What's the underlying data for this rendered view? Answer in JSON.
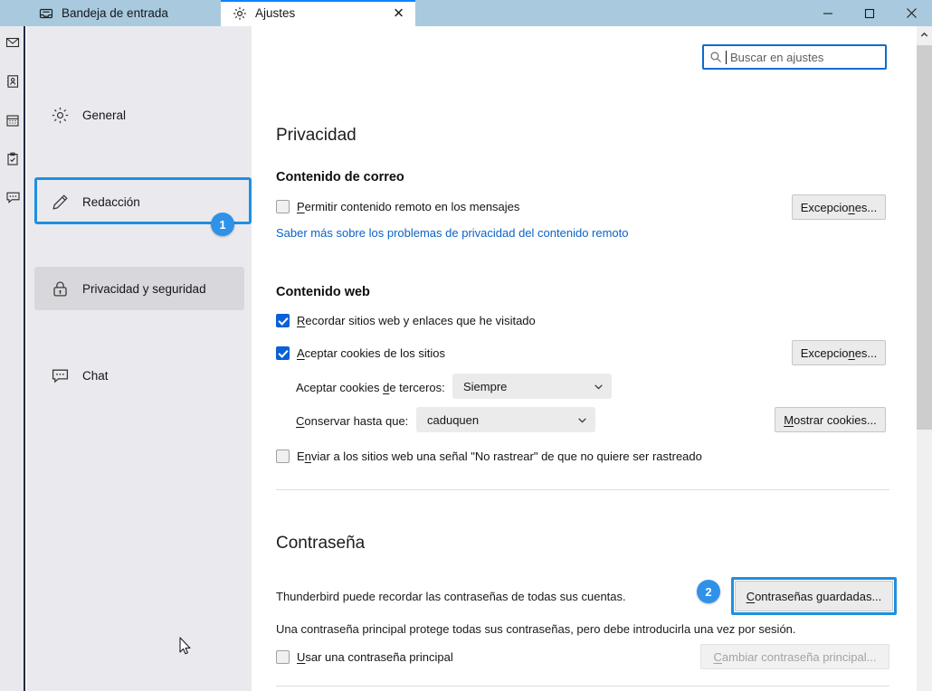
{
  "window": {
    "controls": {
      "minimize": "minimize-icon",
      "maximize": "maximize-icon",
      "close": "close-icon"
    }
  },
  "tabs": [
    {
      "label": "Bandeja de entrada",
      "icon": "inbox-icon",
      "active": false
    },
    {
      "label": "Ajustes",
      "icon": "gear-icon",
      "active": true,
      "closable": true
    }
  ],
  "icon_strip": [
    "mail-icon",
    "address-book-icon",
    "calendar-icon",
    "tasks-icon",
    "chat-icon"
  ],
  "nav": {
    "items": [
      {
        "label": "General",
        "icon": "gear-icon",
        "selected": false
      },
      {
        "label": "Redacción",
        "icon": "pencil-icon",
        "selected": false
      },
      {
        "label": "Privacidad y seguridad",
        "icon": "lock-icon",
        "selected": true,
        "badge": "1"
      },
      {
        "label": "Chat",
        "icon": "chat-bubble-icon",
        "selected": false
      }
    ]
  },
  "search": {
    "placeholder": "Buscar en ajustes",
    "value": "",
    "icon": "search-icon"
  },
  "page": {
    "title": "Privacidad",
    "sections": {
      "mail_content": {
        "heading": "Contenido de correo",
        "allow_remote": {
          "label_pre": "",
          "label_key": "P",
          "label_post": "ermitir contenido remoto en los mensajes",
          "checked": false
        },
        "learn_more_link": "Saber más sobre los problemas de privacidad del contenido remoto",
        "exceptions_button": {
          "pre": "Excepcio",
          "key": "n",
          "post": "es..."
        }
      },
      "web_content": {
        "heading": "Contenido web",
        "remember_sites": {
          "label_pre": "",
          "label_key": "R",
          "label_post": "ecordar sitios web y enlaces que he visitado",
          "checked": true
        },
        "accept_cookies": {
          "label_pre": "",
          "label_key": "A",
          "label_post": "ceptar cookies de los sitios",
          "checked": true
        },
        "exceptions_button": {
          "pre": "Excepcio",
          "key": "n",
          "post": "es..."
        },
        "third_party": {
          "label_pre": "Aceptar cookies ",
          "label_key": "d",
          "label_post": "e terceros:",
          "value": "Siempre"
        },
        "keep_until": {
          "label_pre": "",
          "label_key": "C",
          "label_post": "onservar hasta que:",
          "value": "caduquen"
        },
        "show_cookies_button": {
          "pre": "",
          "key": "M",
          "post": "ostrar cookies..."
        },
        "do_not_track": {
          "label_pre": "E",
          "label_key": "n",
          "label_post": "viar a los sitios web una señal \"No rastrear\" de que no quiere ser rastreado",
          "checked": false
        }
      },
      "password": {
        "heading": "Contraseña",
        "description": "Thunderbird puede recordar las contraseñas de todas sus cuentas.",
        "saved_passwords_button": {
          "pre": "",
          "key": "C",
          "post": "ontraseñas guardadas..."
        },
        "saved_passwords_badge": "2",
        "master_note": "Una contraseña principal protege todas sus contraseñas, pero debe introducirla una vez por sesión.",
        "use_master": {
          "label_pre": "",
          "label_key": "U",
          "label_post": "sar una contraseña principal",
          "checked": false
        },
        "change_master_button": {
          "pre": "",
          "key": "C",
          "post": "ambiar contraseña principal..."
        },
        "change_master_disabled": true
      }
    }
  },
  "colors": {
    "accent": "#0a60d8",
    "titlebar": "#a9cade",
    "highlight": "#1e8fe0",
    "badge": "#2f92e8",
    "link": "#0a63c6"
  }
}
